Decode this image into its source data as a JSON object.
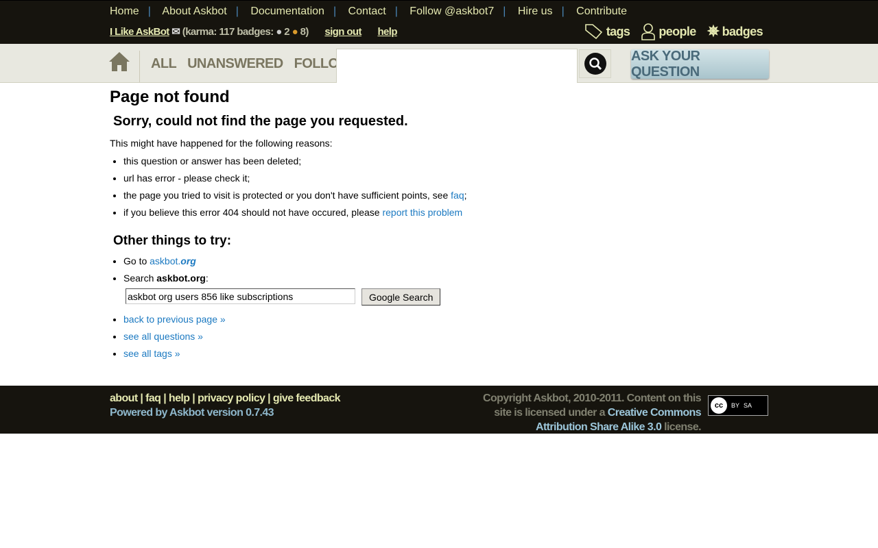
{
  "topnav": [
    "Home",
    "About Askbot",
    "Documentation",
    "Contact",
    "Follow @askbot7",
    "Hire us",
    "Contribute"
  ],
  "user": {
    "name": "I Like AskBot",
    "karma_prefix": "(karma: 117 badges:",
    "silver": "2",
    "bronze": "8",
    "sign_out": "sign out",
    "help": "help"
  },
  "right_nav": {
    "tags": "tags",
    "people": "people",
    "badges": "badges"
  },
  "scopes": [
    "ALL",
    "UNANSWERED",
    "FOLLOWED"
  ],
  "search": {
    "value": ""
  },
  "ask_button": "ASK YOUR QUESTION",
  "main": {
    "title": "Page not found",
    "subtitle": "Sorry, could not find the page you requested.",
    "intro": "This might have happened for the following reasons:",
    "reasons": [
      "this question or answer has been deleted;",
      "url has error - please check it;",
      "the page you tried to visit is protected or you don't have sufficient points, see ",
      "if you believe this error 404 should not have occured, please "
    ],
    "faq_link": "faq",
    "report_link": "report this problem",
    "other_title": "Other things to try:",
    "goto_prefix": "Go to ",
    "goto_link_a": "askbot.",
    "goto_link_b": "org",
    "search_prefix": "Search ",
    "search_site": "askbot.org",
    "google_value": "askbot org users 856 like subscriptions",
    "google_button": "Google Search",
    "links": [
      "back to previous page »",
      "see all questions »",
      "see all tags »"
    ]
  },
  "footer": {
    "links": [
      "about",
      "faq",
      "help",
      "privacy policy",
      "give feedback"
    ],
    "powered": "Powered by Askbot version 0.7.43",
    "copy1": "Copyright Askbot, 2010-2011. Content on this site is licensed under a ",
    "license": "Creative Commons Attribution Share Alike 3.0",
    "copy2": " license.",
    "cc_by": "BY",
    "cc_sa": "SA"
  },
  "colors": {
    "header_bg": "#16140e",
    "link": "#1b79c1",
    "nav_text": "#e4e8b0"
  }
}
